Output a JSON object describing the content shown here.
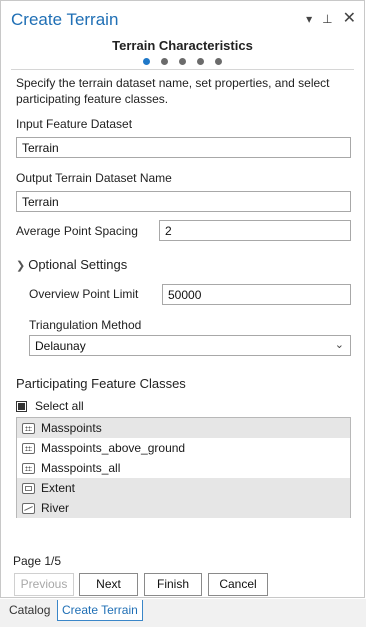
{
  "window": {
    "title": "Create Terrain"
  },
  "header": {
    "section_title": "Terrain Characteristics",
    "page_count": 5,
    "current_page_index": 0
  },
  "description": "Specify the terrain dataset name, set properties, and select participating feature classes.",
  "fields": {
    "input_feature_dataset": {
      "label": "Input Feature Dataset",
      "value": "Terrain"
    },
    "output_terrain_name": {
      "label": "Output Terrain Dataset Name",
      "value": "Terrain"
    },
    "avg_point_spacing": {
      "label": "Average Point Spacing",
      "value": "2"
    }
  },
  "optional": {
    "label": "Optional Settings",
    "overview_point_limit": {
      "label": "Overview Point Limit",
      "value": "50000"
    },
    "triangulation_method": {
      "label": "Triangulation Method",
      "value": "Delaunay"
    }
  },
  "participating": {
    "title": "Participating Feature Classes",
    "select_all_label": "Select all",
    "items": [
      {
        "label": "Masspoints",
        "icon": "point-feature-icon",
        "selected": true
      },
      {
        "label": "Masspoints_above_ground",
        "icon": "point-feature-icon",
        "selected": false
      },
      {
        "label": "Masspoints_all",
        "icon": "point-feature-icon",
        "selected": false
      },
      {
        "label": "Extent",
        "icon": "polygon-feature-icon",
        "selected": true
      },
      {
        "label": "River",
        "icon": "line-feature-icon",
        "selected": true
      }
    ]
  },
  "footer": {
    "page_label": "Page 1/5",
    "previous_label": "Previous",
    "next_label": "Next",
    "finish_label": "Finish",
    "cancel_label": "Cancel"
  },
  "tabs": [
    {
      "label": "Catalog",
      "active": false
    },
    {
      "label": "Create Terrain",
      "active": true
    }
  ],
  "colors": {
    "accent": "#1f78c8",
    "title": "#1f6fb5",
    "selected_row": "#e6e6e6"
  }
}
